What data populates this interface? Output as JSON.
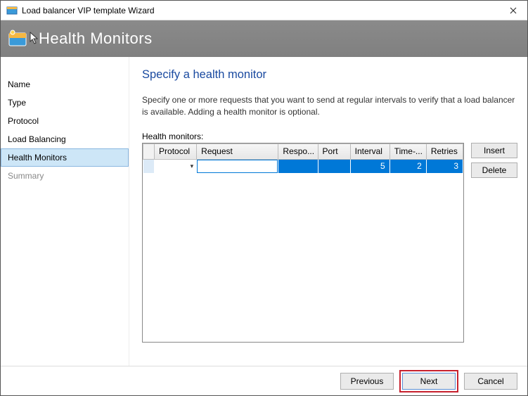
{
  "window": {
    "title": "Load balancer VIP template Wizard"
  },
  "header": {
    "title": "Health Monitors"
  },
  "sidebar": {
    "items": [
      {
        "label": "Name"
      },
      {
        "label": "Type"
      },
      {
        "label": "Protocol"
      },
      {
        "label": "Load Balancing"
      },
      {
        "label": "Health Monitors"
      },
      {
        "label": "Summary"
      }
    ],
    "active_index": 4,
    "dim_index": 5
  },
  "page": {
    "heading": "Specify a health monitor",
    "description": "Specify one or more requests that you want to send at regular intervals to verify that a load balancer is available. Adding a health monitor is optional.",
    "table_label": "Health monitors:"
  },
  "table": {
    "columns": [
      "Protocol",
      "Request",
      "Respo...",
      "Port",
      "Interval",
      "Time-...",
      "Retries"
    ],
    "rows": [
      {
        "protocol": "",
        "request": "",
        "response": "",
        "port": "",
        "interval": "5",
        "timeout": "2",
        "retries": "3"
      }
    ]
  },
  "buttons": {
    "insert": "Insert",
    "delete": "Delete",
    "previous": "Previous",
    "next": "Next",
    "cancel": "Cancel"
  }
}
